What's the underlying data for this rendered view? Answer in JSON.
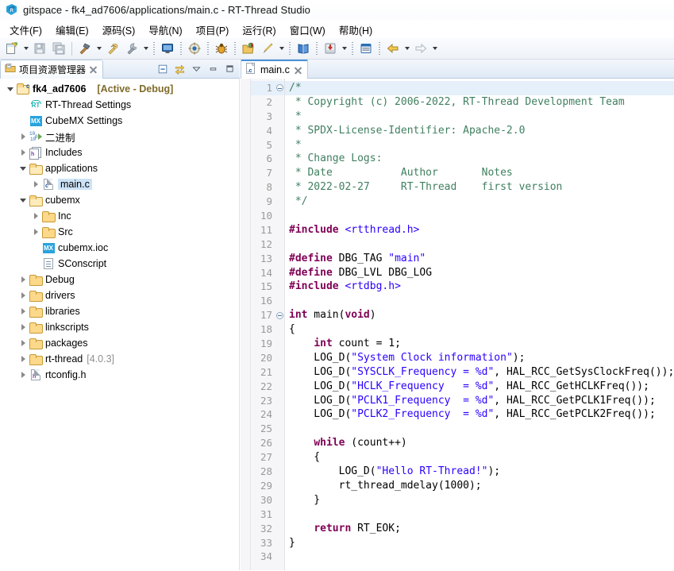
{
  "window": {
    "title": "gitspace - fk4_ad7606/applications/main.c - RT-Thread Studio",
    "app_icon": "rt-thread-logo-icon"
  },
  "menubar": {
    "items": [
      {
        "label": "文件(F)",
        "name": "menu-file"
      },
      {
        "label": "编辑(E)",
        "name": "menu-edit"
      },
      {
        "label": "源码(S)",
        "name": "menu-source"
      },
      {
        "label": "导航(N)",
        "name": "menu-navigate"
      },
      {
        "label": "项目(P)",
        "name": "menu-project"
      },
      {
        "label": "运行(R)",
        "name": "menu-run"
      },
      {
        "label": "窗口(W)",
        "name": "menu-window"
      },
      {
        "label": "帮助(H)",
        "name": "menu-help"
      }
    ]
  },
  "toolbar": {
    "buttons": [
      {
        "name": "new-file-icon",
        "glyph": "new"
      },
      {
        "name": "new-file-dropdown-arrow-icon",
        "glyph": "arrow"
      },
      {
        "name": "save-icon",
        "glyph": "save"
      },
      {
        "name": "save-all-icon",
        "glyph": "saveall"
      },
      {
        "name": "separator",
        "glyph": "sep"
      },
      {
        "name": "build-hammer-icon",
        "glyph": "hammer"
      },
      {
        "name": "build-dropdown-arrow-icon",
        "glyph": "arrow"
      },
      {
        "name": "clean-project-icon",
        "glyph": "clean"
      },
      {
        "name": "wrench-settings-icon",
        "glyph": "wrench"
      },
      {
        "name": "wrench-dropdown-arrow-icon",
        "glyph": "arrow"
      },
      {
        "name": "separator-dotted",
        "glyph": "sepdot"
      },
      {
        "name": "terminal-monitor-icon",
        "glyph": "monitor"
      },
      {
        "name": "separator-dotted",
        "glyph": "sepdot"
      },
      {
        "name": "debug-config-gear-icon",
        "glyph": "gear"
      },
      {
        "name": "separator-dotted",
        "glyph": "sepdot"
      },
      {
        "name": "debug-bug-icon",
        "glyph": "bug"
      },
      {
        "name": "separator-dotted",
        "glyph": "sepdot"
      },
      {
        "name": "open-package-icon",
        "glyph": "pkg"
      },
      {
        "name": "flash-download-icon",
        "glyph": "rocket"
      },
      {
        "name": "flash-dropdown-arrow-icon",
        "glyph": "arrow"
      },
      {
        "name": "separator-dotted",
        "glyph": "sepdot"
      },
      {
        "name": "documentation-book-icon",
        "glyph": "book"
      },
      {
        "name": "separator-dotted",
        "glyph": "sepdot"
      },
      {
        "name": "import-project-icon",
        "glyph": "import"
      },
      {
        "name": "import-dropdown-arrow-icon",
        "glyph": "arrow"
      },
      {
        "name": "separator-dotted",
        "glyph": "sepdot"
      },
      {
        "name": "serial-terminal-icon",
        "glyph": "term"
      },
      {
        "name": "separator-dotted",
        "glyph": "sepdot"
      },
      {
        "name": "back-navigation-icon",
        "glyph": "back"
      },
      {
        "name": "back-dropdown-arrow-icon",
        "glyph": "arrow"
      },
      {
        "name": "forward-navigation-icon",
        "glyph": "fwd"
      },
      {
        "name": "forward-dropdown-arrow-icon",
        "glyph": "arrow"
      }
    ]
  },
  "project_explorer": {
    "tab_label": "项目资源管理器",
    "view_buttons": [
      {
        "name": "collapse-all-icon"
      },
      {
        "name": "link-with-editor-icon"
      },
      {
        "name": "view-menu-icon"
      },
      {
        "name": "minimize-view-icon"
      },
      {
        "name": "maximize-view-icon"
      }
    ],
    "tree": [
      {
        "label": "fk4_ad7606",
        "suffix": "[Active - Debug]",
        "icon": "project-icon",
        "indent": 0,
        "twisty": "down",
        "bold": true,
        "name": "tree-item-project"
      },
      {
        "label": "RT-Thread Settings",
        "icon": "rt-thread-icon",
        "indent": 1,
        "twisty": "none",
        "name": "tree-item-rt-thread-settings"
      },
      {
        "label": "CubeMX Settings",
        "icon": "cubemx-icon",
        "indent": 1,
        "twisty": "none",
        "name": "tree-item-cubemx-settings"
      },
      {
        "label": "二进制",
        "icon": "binaries-icon",
        "indent": 1,
        "twisty": "right",
        "name": "tree-item-binaries"
      },
      {
        "label": "Includes",
        "icon": "includes-icon",
        "indent": 1,
        "twisty": "right",
        "name": "tree-item-includes"
      },
      {
        "label": "applications",
        "icon": "folder-open-icon",
        "indent": 1,
        "twisty": "down",
        "name": "tree-item-applications"
      },
      {
        "label": "main.c",
        "icon": "c-file-icon",
        "indent": 2,
        "twisty": "right",
        "selected": true,
        "name": "tree-item-main-c"
      },
      {
        "label": "cubemx",
        "icon": "folder-open-icon",
        "indent": 1,
        "twisty": "down",
        "name": "tree-item-cubemx"
      },
      {
        "label": "Inc",
        "icon": "folder-icon",
        "indent": 2,
        "twisty": "right",
        "name": "tree-item-inc"
      },
      {
        "label": "Src",
        "icon": "folder-icon",
        "indent": 2,
        "twisty": "right",
        "name": "tree-item-src"
      },
      {
        "label": "cubemx.ioc",
        "icon": "cubemx-icon",
        "indent": 2,
        "twisty": "none",
        "name": "tree-item-cubemx-ioc"
      },
      {
        "label": "SConscript",
        "icon": "script-file-icon",
        "indent": 2,
        "twisty": "none",
        "name": "tree-item-sconscript"
      },
      {
        "label": "Debug",
        "icon": "folder-icon",
        "indent": 1,
        "twisty": "right",
        "name": "tree-item-debug"
      },
      {
        "label": "drivers",
        "icon": "folder-icon",
        "indent": 1,
        "twisty": "right",
        "name": "tree-item-drivers"
      },
      {
        "label": "libraries",
        "icon": "folder-icon",
        "indent": 1,
        "twisty": "right",
        "name": "tree-item-libraries"
      },
      {
        "label": "linkscripts",
        "icon": "folder-icon",
        "indent": 1,
        "twisty": "right",
        "name": "tree-item-linkscripts"
      },
      {
        "label": "packages",
        "icon": "folder-icon",
        "indent": 1,
        "twisty": "right",
        "name": "tree-item-packages"
      },
      {
        "label": "rt-thread",
        "version": "[4.0.3]",
        "icon": "folder-icon",
        "indent": 1,
        "twisty": "right",
        "name": "tree-item-rt-thread"
      },
      {
        "label": "rtconfig.h",
        "icon": "h-file-icon",
        "indent": 1,
        "twisty": "right",
        "name": "tree-item-rtconfig-h"
      }
    ]
  },
  "editor": {
    "tab": {
      "label": "main.c",
      "icon": "c-file-icon",
      "close": "close-icon"
    },
    "current_line": 1,
    "fold_lines": [
      1,
      17
    ],
    "first_line": 1,
    "last_line": 34,
    "lines": [
      {
        "n": 1,
        "tokens": [
          {
            "t": "/*",
            "c": "com"
          }
        ]
      },
      {
        "n": 2,
        "tokens": [
          {
            "t": " * Copyright (c) 2006-2022, RT-Thread Development Team",
            "c": "com"
          }
        ]
      },
      {
        "n": 3,
        "tokens": [
          {
            "t": " *",
            "c": "com"
          }
        ]
      },
      {
        "n": 4,
        "tokens": [
          {
            "t": " * SPDX-License-Identifier: Apache-2.0",
            "c": "com"
          }
        ]
      },
      {
        "n": 5,
        "tokens": [
          {
            "t": " *",
            "c": "com"
          }
        ]
      },
      {
        "n": 6,
        "tokens": [
          {
            "t": " * Change Logs:",
            "c": "com"
          }
        ]
      },
      {
        "n": 7,
        "tokens": [
          {
            "t": " * Date           Author       Notes",
            "c": "com"
          }
        ]
      },
      {
        "n": 8,
        "tokens": [
          {
            "t": " * 2022-02-27     RT-Thread    first version",
            "c": "com"
          }
        ]
      },
      {
        "n": 9,
        "tokens": [
          {
            "t": " */",
            "c": "com"
          }
        ]
      },
      {
        "n": 10,
        "tokens": []
      },
      {
        "n": 11,
        "tokens": [
          {
            "t": "#include ",
            "c": "pp"
          },
          {
            "t": "<rtthread.h>",
            "c": "inc"
          }
        ]
      },
      {
        "n": 12,
        "tokens": []
      },
      {
        "n": 13,
        "tokens": [
          {
            "t": "#define",
            "c": "pp"
          },
          {
            "t": " DBG_TAG ",
            "c": "pl"
          },
          {
            "t": "\"main\"",
            "c": "str"
          }
        ]
      },
      {
        "n": 14,
        "tokens": [
          {
            "t": "#define",
            "c": "pp"
          },
          {
            "t": " DBG_LVL DBG_LOG",
            "c": "pl"
          }
        ]
      },
      {
        "n": 15,
        "tokens": [
          {
            "t": "#include ",
            "c": "pp"
          },
          {
            "t": "<rtdbg.h>",
            "c": "inc"
          }
        ]
      },
      {
        "n": 16,
        "tokens": []
      },
      {
        "n": 17,
        "tokens": [
          {
            "t": "int",
            "c": "kw"
          },
          {
            "t": " main(",
            "c": "pl"
          },
          {
            "t": "void",
            "c": "kw"
          },
          {
            "t": ")",
            "c": "pl"
          }
        ]
      },
      {
        "n": 18,
        "tokens": [
          {
            "t": "{",
            "c": "pl"
          }
        ]
      },
      {
        "n": 19,
        "tokens": [
          {
            "t": "    ",
            "c": "pl"
          },
          {
            "t": "int",
            "c": "kw"
          },
          {
            "t": " count = 1;",
            "c": "pl"
          }
        ]
      },
      {
        "n": 20,
        "tokens": [
          {
            "t": "    LOG_D(",
            "c": "pl"
          },
          {
            "t": "\"System Clock information\"",
            "c": "str"
          },
          {
            "t": ");",
            "c": "pl"
          }
        ]
      },
      {
        "n": 21,
        "tokens": [
          {
            "t": "    LOG_D(",
            "c": "pl"
          },
          {
            "t": "\"SYSCLK_Frequency = %d\"",
            "c": "str"
          },
          {
            "t": ", HAL_RCC_GetSysClockFreq());",
            "c": "pl"
          }
        ]
      },
      {
        "n": 22,
        "tokens": [
          {
            "t": "    LOG_D(",
            "c": "pl"
          },
          {
            "t": "\"HCLK_Frequency   = %d\"",
            "c": "str"
          },
          {
            "t": ", HAL_RCC_GetHCLKFreq());",
            "c": "pl"
          }
        ]
      },
      {
        "n": 23,
        "tokens": [
          {
            "t": "    LOG_D(",
            "c": "pl"
          },
          {
            "t": "\"PCLK1_Frequency  = %d\"",
            "c": "str"
          },
          {
            "t": ", HAL_RCC_GetPCLK1Freq());",
            "c": "pl"
          }
        ]
      },
      {
        "n": 24,
        "tokens": [
          {
            "t": "    LOG_D(",
            "c": "pl"
          },
          {
            "t": "\"PCLK2_Frequency  = %d\"",
            "c": "str"
          },
          {
            "t": ", HAL_RCC_GetPCLK2Freq());",
            "c": "pl"
          }
        ]
      },
      {
        "n": 25,
        "tokens": []
      },
      {
        "n": 26,
        "tokens": [
          {
            "t": "    ",
            "c": "pl"
          },
          {
            "t": "while",
            "c": "kw"
          },
          {
            "t": " (count++)",
            "c": "pl"
          }
        ]
      },
      {
        "n": 27,
        "tokens": [
          {
            "t": "    {",
            "c": "pl"
          }
        ]
      },
      {
        "n": 28,
        "tokens": [
          {
            "t": "        LOG_D(",
            "c": "pl"
          },
          {
            "t": "\"Hello RT-Thread!\"",
            "c": "str"
          },
          {
            "t": ");",
            "c": "pl"
          }
        ]
      },
      {
        "n": 29,
        "tokens": [
          {
            "t": "        rt_thread_mdelay(1000);",
            "c": "pl"
          }
        ]
      },
      {
        "n": 30,
        "tokens": [
          {
            "t": "    }",
            "c": "pl"
          }
        ]
      },
      {
        "n": 31,
        "tokens": []
      },
      {
        "n": 32,
        "tokens": [
          {
            "t": "    ",
            "c": "pl"
          },
          {
            "t": "return",
            "c": "kw"
          },
          {
            "t": " RT_EOK;",
            "c": "pl"
          }
        ]
      },
      {
        "n": 33,
        "tokens": [
          {
            "t": "}",
            "c": "pl"
          }
        ]
      },
      {
        "n": 34,
        "tokens": []
      }
    ]
  },
  "colors": {
    "comment": "#3f7f5f",
    "keyword": "#7f0055",
    "string": "#2a00ff",
    "selection": "#cde3f7",
    "current_line": "#e6f0fa",
    "active_debug_label": "#7f6b2a"
  }
}
